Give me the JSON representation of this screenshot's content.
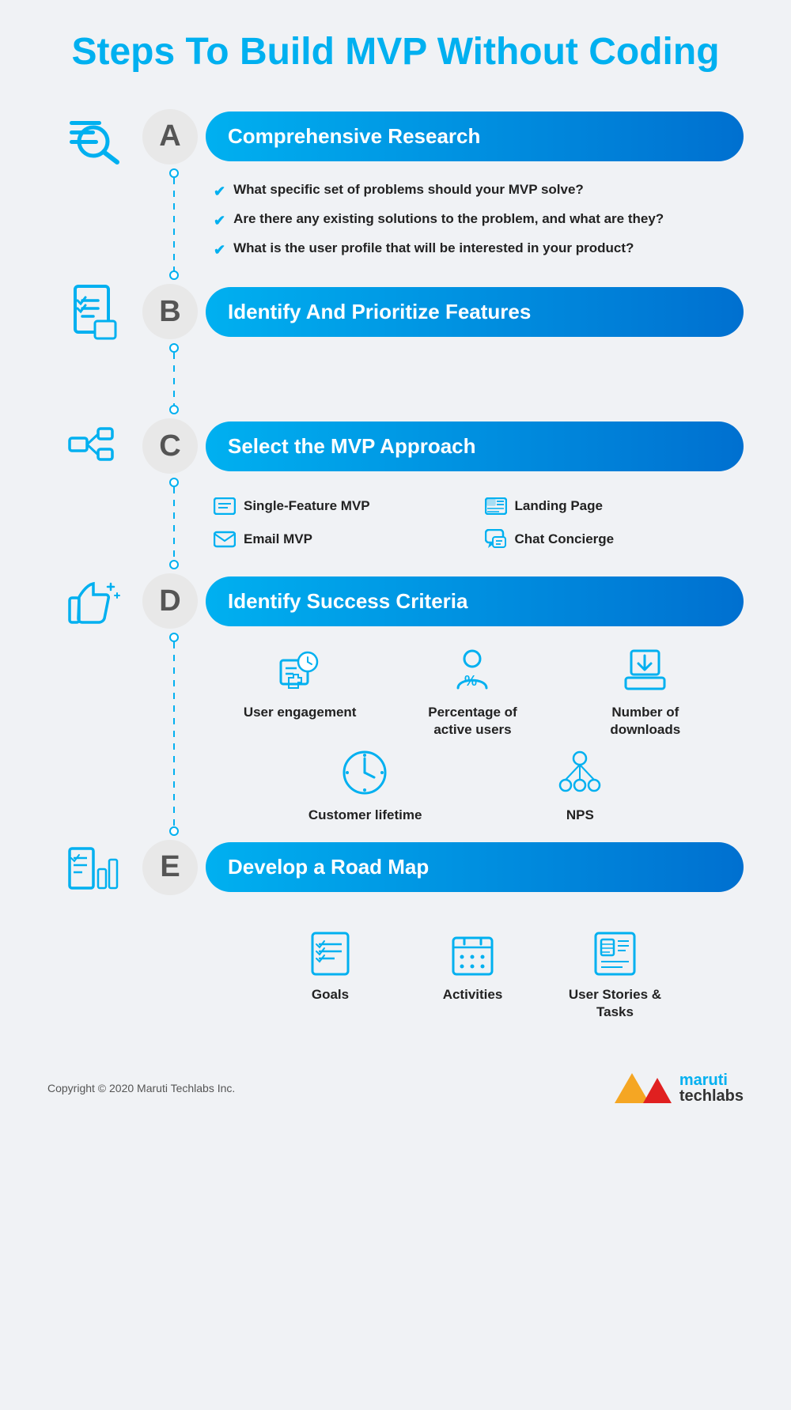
{
  "title": "Steps To Build MVP Without Coding",
  "steps": [
    {
      "letter": "A",
      "label": "Comprehensive Research",
      "checklist": [
        "What specific set of problems should your MVP solve?",
        "Are there any existing solutions to the problem, and what are they?",
        "What is the user profile that will be interested in your product?"
      ]
    },
    {
      "letter": "B",
      "label": "Identify And Prioritize Features"
    },
    {
      "letter": "C",
      "label": "Select the MVP Approach",
      "mvp_options": [
        {
          "icon": "☰",
          "label": "Single-Feature MVP"
        },
        {
          "icon": "▦",
          "label": "Landing Page"
        },
        {
          "icon": "✉",
          "label": "Email MVP"
        },
        {
          "icon": "💬",
          "label": "Chat Concierge"
        }
      ]
    },
    {
      "letter": "D",
      "label": "Identify Success Criteria",
      "criteria": [
        {
          "label": "User engagement"
        },
        {
          "label": "Percentage of active users"
        },
        {
          "label": "Number of downloads"
        },
        {
          "label": "Customer lifetime"
        },
        {
          "label": "NPS"
        }
      ]
    },
    {
      "letter": "E",
      "label": "Develop a Road Map",
      "roadmap": [
        {
          "label": "Goals"
        },
        {
          "label": "Activities"
        },
        {
          "label": "User Stories & Tasks"
        }
      ]
    }
  ],
  "footer": {
    "copyright": "Copyright © 2020 Maruti Techlabs Inc.",
    "brand_maruti": "maruti",
    "brand_techlabs": "techlabs"
  }
}
